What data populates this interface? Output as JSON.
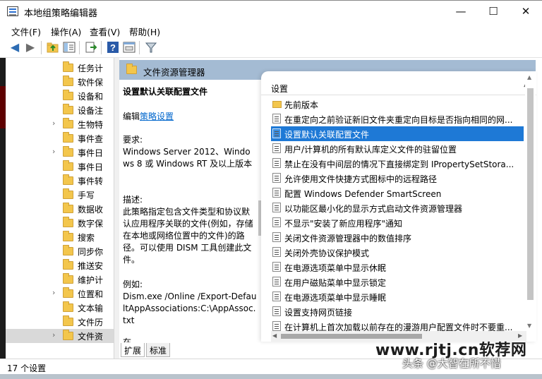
{
  "window": {
    "title": "本地组策略编辑器",
    "min": "—",
    "max": "☐",
    "close": "✕"
  },
  "menu": [
    "文件(F)",
    "操作(A)",
    "查看(V)",
    "帮助(H)"
  ],
  "tree": {
    "items": [
      {
        "label": "任务计",
        "expandable": false
      },
      {
        "label": "软件保",
        "expandable": false
      },
      {
        "label": "设备和",
        "expandable": false
      },
      {
        "label": "设备注",
        "expandable": false
      },
      {
        "label": "生物特",
        "expandable": true
      },
      {
        "label": "事件查",
        "expandable": false
      },
      {
        "label": "事件日",
        "expandable": true
      },
      {
        "label": "事件日",
        "expandable": false
      },
      {
        "label": "事件转",
        "expandable": false
      },
      {
        "label": "手写",
        "expandable": false
      },
      {
        "label": "数据收",
        "expandable": false
      },
      {
        "label": "数字保",
        "expandable": false
      },
      {
        "label": "搜索",
        "expandable": false
      },
      {
        "label": "同步你",
        "expandable": false
      },
      {
        "label": "推送安",
        "expandable": false
      },
      {
        "label": "维护计",
        "expandable": false
      },
      {
        "label": "位置和",
        "expandable": true
      },
      {
        "label": "文本输",
        "expandable": false
      },
      {
        "label": "文件历",
        "expandable": false
      },
      {
        "label": "文件资",
        "expandable": true,
        "selected": true
      }
    ]
  },
  "pane": {
    "header": "文件资源管理器"
  },
  "description": {
    "title": "设置默认关联配置文件",
    "edit_prefix": "编辑",
    "edit_link": "策略设置",
    "requirements_label": "要求:",
    "requirements": "Windows Server 2012、Windows 8 或 Windows RT 及以上版本",
    "desc_label": "描述:",
    "desc": "此策略指定包含文件类型和协议默认应用程序关联的文件(例如，存储在本地或网络位置中的文件)的路径。可以使用 DISM 工具创建此文件。",
    "example_label": "例如:",
    "example": "Dism.exe /Online /Export-DefaultAppAssociations:C:\\AppAssoc.txt",
    "cut_text": "在"
  },
  "list": {
    "column": "设置",
    "rows": [
      {
        "text": "先前版本",
        "type": "folder"
      },
      {
        "text": "在重定向之前验证新旧文件夹重定向目标是否指向相同的网...",
        "type": "setting"
      },
      {
        "text": "设置默认关联配置文件",
        "type": "setting",
        "selected": true
      },
      {
        "text": "用户/计算机的所有默认库定义文件的驻留位置",
        "type": "setting"
      },
      {
        "text": "禁止在没有中间层的情况下直接绑定到 IPropertySetStora...",
        "type": "setting"
      },
      {
        "text": "允许使用文件快捷方式图标中的远程路径",
        "type": "setting"
      },
      {
        "text": "配置 Windows Defender SmartScreen",
        "type": "setting"
      },
      {
        "text": "以功能区最小化的显示方式启动文件资源管理器",
        "type": "setting"
      },
      {
        "text": "不显示\"安装了新应用程序\"通知",
        "type": "setting"
      },
      {
        "text": "关闭文件资源管理器中的数值排序",
        "type": "setting"
      },
      {
        "text": "关闭外壳协议保护模式",
        "type": "setting"
      },
      {
        "text": "在电源选项菜单中显示休眠",
        "type": "setting"
      },
      {
        "text": "在用户磁贴菜单中显示锁定",
        "type": "setting"
      },
      {
        "text": "在电源选项菜单中显示睡眠",
        "type": "setting"
      },
      {
        "text": "设置支持网页链接",
        "type": "setting"
      },
      {
        "text": "在计算机上首次加载以前存在的漫游用户配置文件时不要重...",
        "type": "setting"
      }
    ]
  },
  "tabs": [
    "扩展",
    "标准"
  ],
  "status": "17 个设置",
  "watermark": {
    "url": "www.rjtj.cn软荐网",
    "sub": "头条 @大智在所不惜"
  }
}
